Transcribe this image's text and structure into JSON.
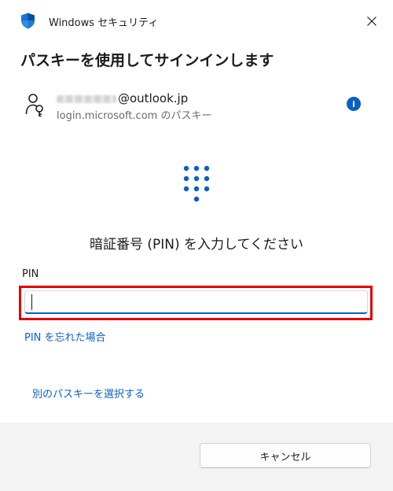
{
  "window": {
    "app_title": "Windows セキュリティ",
    "heading": "パスキーを使用してサインインします"
  },
  "account": {
    "user_suffix": "@outlook.jp",
    "site": "login.microsoft.com のパスキー"
  },
  "prompt": "暗証番号 (PIN) を入力してください",
  "pin": {
    "label": "PIN",
    "value": ""
  },
  "links": {
    "forgot_pin": "PIN を忘れた場合",
    "other_passkey": "別のパスキーを選択する"
  },
  "footer": {
    "cancel_label": "キャンセル"
  },
  "icons": {
    "shield": "shield-icon",
    "close": "close-icon",
    "key": "passkey-icon",
    "info": "info-icon",
    "keypad": "keypad-icon"
  },
  "colors": {
    "accent": "#0a5fc4",
    "highlight": "#e00000",
    "footer_bg": "#f3f3f3"
  }
}
